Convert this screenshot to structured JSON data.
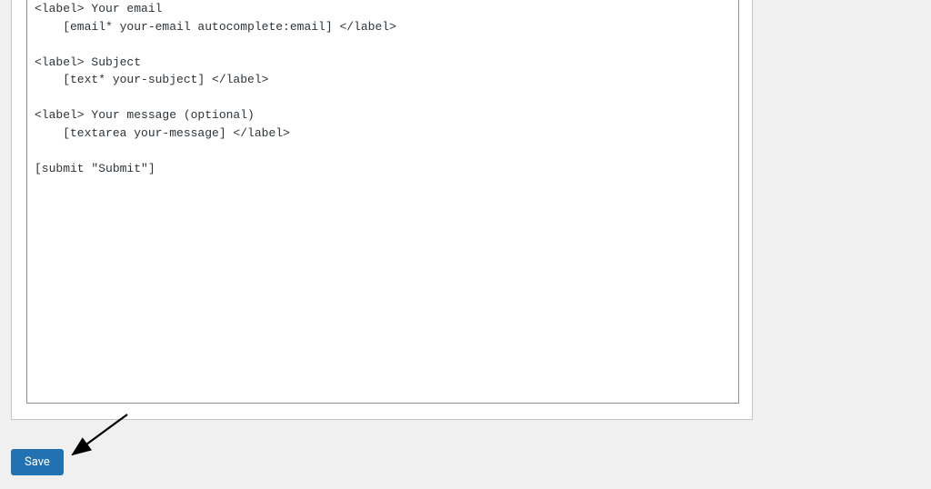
{
  "editor": {
    "content": "<label> Your email\n    [email* your-email autocomplete:email] </label>\n\n<label> Subject\n    [text* your-subject] </label>\n\n<label> Your message (optional)\n    [textarea your-message] </label>\n\n[submit \"Submit\"]"
  },
  "buttons": {
    "save_label": "Save"
  }
}
